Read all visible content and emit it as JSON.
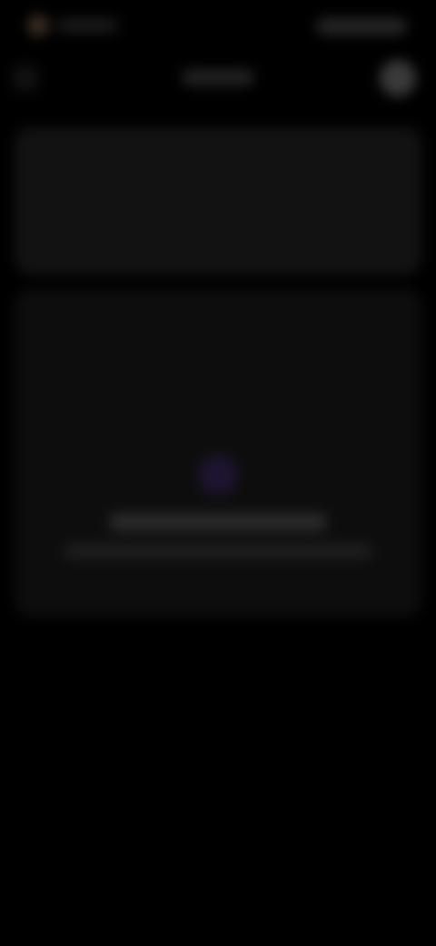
{
  "colors": {
    "background": "#000000",
    "card_top": "#121212",
    "card_main": "#0d0d0d",
    "accent_icon": "#1e1430",
    "avatar": "#3a3a3a"
  },
  "icons": {
    "status_left": "app-indicator-icon",
    "header_left": "back-icon",
    "header_right": "avatar-icon",
    "empty_state": "empty-state-icon"
  }
}
